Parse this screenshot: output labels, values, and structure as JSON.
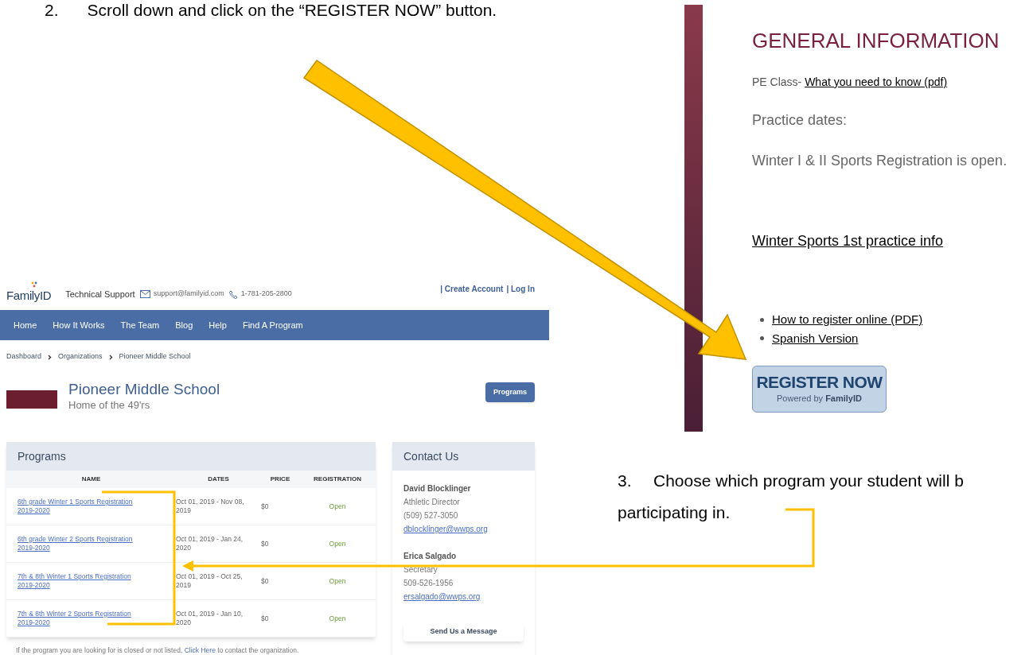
{
  "step_2": {
    "number": "2.",
    "text": "Scroll down and click on the “REGISTER NOW” button."
  },
  "familyid_page": {
    "logo": "FamilyID",
    "support_label": "Technical Support",
    "support_email": "support@familyid.com",
    "support_phone": "1-781-205-2800",
    "account_links": [
      "| Create Account",
      "| Log In"
    ],
    "nav": [
      "Home",
      "How It Works",
      "The Team",
      "Blog",
      "Help",
      "Find A Program"
    ],
    "breadcrumb": [
      "Dashboard",
      "Organizations",
      "Pioneer Middle School"
    ],
    "org": {
      "name": "Pioneer Middle School",
      "tagline": "Home of the 49'rs",
      "button": "Programs"
    },
    "programs": {
      "title": "Programs",
      "columns": [
        "NAME",
        "DATES",
        "PRICE",
        "REGISTRATION"
      ],
      "rows": [
        {
          "name": "6th grade Winter 1 Sports Registration 2019-2020",
          "dates": "Oct 01, 2019 - Nov 08, 2019",
          "price": "$0",
          "registration": "Open"
        },
        {
          "name": "6th grade Winter 2 Sports Registration 2019-2020",
          "dates": "Oct 01, 2019 - Jan 24, 2020",
          "price": "$0",
          "registration": "Open"
        },
        {
          "name": "7th & 8th Winter 1 Sports Registration 2019-2020",
          "dates": "Oct 01, 2019 - Oct 25, 2019",
          "price": "$0",
          "registration": "Open"
        },
        {
          "name": "7th & 8th Winter 2 Sports Registration 2019-2020",
          "dates": "Oct 01, 2019 - Jan 10, 2020",
          "price": "$0",
          "registration": "Open"
        }
      ],
      "footer": {
        "before": "If the program you are looking for is closed or not listed,",
        "link": "Click Here",
        "after": "to contact the organization."
      }
    },
    "contact": {
      "title": "Contact Us",
      "people": [
        {
          "name": "David Blocklinger",
          "role": "Athletic Director",
          "phone": "(509) 527-3050",
          "email": "dblocklinger@wwps.org"
        },
        {
          "name": "Erica Salgado",
          "role": "Secretary",
          "phone": "509-526-1956",
          "email": "ersalgado@wwps.org"
        }
      ],
      "button": "Send Us a Message"
    }
  },
  "school_page": {
    "heading": "GENERAL INFORMATION",
    "pe_label": "PE Class-",
    "pe_link": "What you need to know (pdf)",
    "practice": "Practice dates:",
    "open_note": "Winter I & II Sports Registration is open.",
    "practice_link": "Winter Sports 1st practice info",
    "links": [
      "How to register online (PDF)",
      "Spanish Version"
    ],
    "register": {
      "title": "REGISTER NOW",
      "powered": "Powered by",
      "brand": "FamilyID"
    }
  },
  "step_3": {
    "number": "3.",
    "lines": [
      "Choose which program your student will b",
      "participating in."
    ]
  }
}
